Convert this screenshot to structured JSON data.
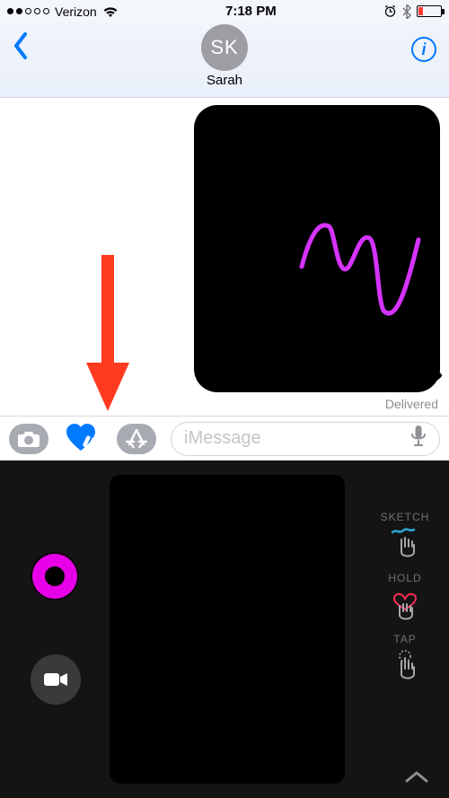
{
  "status": {
    "carrier": "Verizon",
    "time": "7:18 PM"
  },
  "nav": {
    "initials": "SK",
    "contact": "Sarah"
  },
  "chat": {
    "delivered": "Delivered"
  },
  "toolbar": {
    "placeholder": "iMessage"
  },
  "dt": {
    "sketch_label": "SKETCH",
    "hold_label": "HOLD",
    "tap_label": "TAP"
  }
}
